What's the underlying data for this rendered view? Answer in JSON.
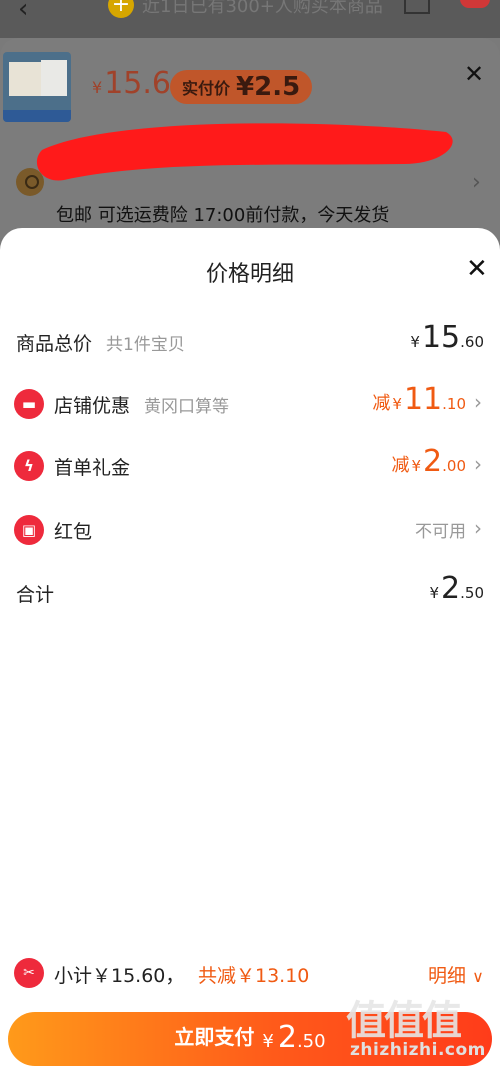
{
  "topbar": {
    "notice": "近1日已有300+人购买本商品",
    "plus": "+"
  },
  "product": {
    "price_symbol": "¥",
    "price": "15.6",
    "actual_label": "实付价",
    "actual_symbol": "¥",
    "actual_amount": "2.5",
    "shipping": "包邮  可选运费险  17:00前付款，今天发货"
  },
  "sheet": {
    "title": "价格明细",
    "rows": [
      {
        "label": "商品总价",
        "sub": "共1件宝贝",
        "prefix": "",
        "yen": "¥",
        "int": "15",
        "dec": ".60"
      },
      {
        "label": "店铺优惠",
        "sub": "黄冈口算等",
        "prefix": "减",
        "yen": "¥",
        "int": "11",
        "dec": ".10"
      },
      {
        "label": "首单礼金",
        "sub": "",
        "prefix": "减",
        "yen": "¥",
        "int": "2",
        "dec": ".00"
      },
      {
        "label": "红包",
        "sub": "",
        "status": "不可用"
      },
      {
        "label": "合计",
        "yen": "¥",
        "int": "2",
        "dec": ".50"
      }
    ]
  },
  "footer": {
    "subtotal": "小计￥15.60，",
    "reduce": "共减￥13.10",
    "detail": "明细",
    "pay_label": "立即支付",
    "pay_yen": "¥",
    "pay_int": "2",
    "pay_dec": ".50"
  },
  "watermark": {
    "text": "zhizhizhi.com",
    "glyphs": "值值值"
  },
  "colors": {
    "accent": "#f05a12",
    "icon_red": "#ee2a3c",
    "button_start": "#ff9a1a",
    "button_end": "#ff3c1a"
  }
}
